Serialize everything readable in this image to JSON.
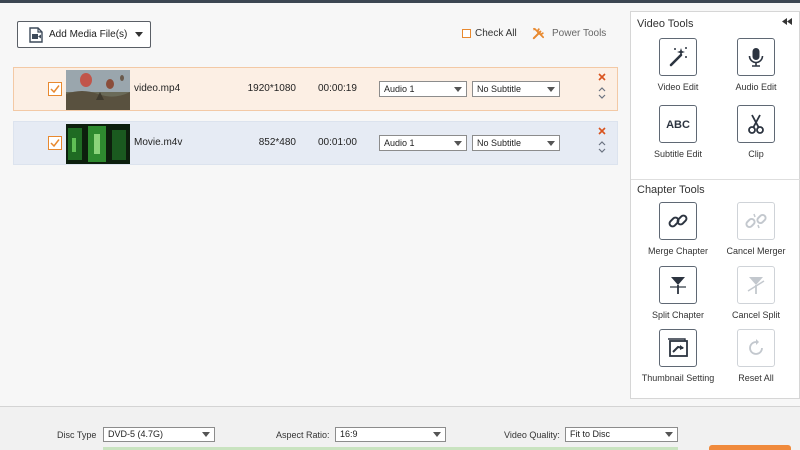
{
  "toolbar": {
    "add_media_label": "Add Media File(s)",
    "check_all_label": "Check All",
    "power_tools_label": "Power Tools"
  },
  "files": [
    {
      "name": "video.mp4",
      "resolution": "1920*1080",
      "duration": "00:00:19",
      "audio": "Audio 1",
      "subtitle": "No Subtitle",
      "selected": true
    },
    {
      "name": "Movie.m4v",
      "resolution": "852*480",
      "duration": "00:01:00",
      "audio": "Audio 1",
      "subtitle": "No Subtitle",
      "selected": false
    }
  ],
  "video_tools": {
    "title": "Video Tools",
    "items": [
      {
        "label": "Video Edit",
        "icon": "magic-wand-icon"
      },
      {
        "label": "Audio Edit",
        "icon": "microphone-icon"
      },
      {
        "label": "Subtitle Edit",
        "icon": "abc-icon"
      },
      {
        "label": "Clip",
        "icon": "scissors-icon"
      }
    ]
  },
  "chapter_tools": {
    "title": "Chapter Tools",
    "items": [
      {
        "label": "Merge Chapter",
        "icon": "link-icon",
        "enabled": true
      },
      {
        "label": "Cancel Merger",
        "icon": "broken-link-icon",
        "enabled": false
      },
      {
        "label": "Split Chapter",
        "icon": "split-icon",
        "enabled": true
      },
      {
        "label": "Cancel Split",
        "icon": "cancel-split-icon",
        "enabled": false
      },
      {
        "label": "Thumbnail Setting",
        "icon": "thumbnail-icon",
        "enabled": true
      },
      {
        "label": "Reset All",
        "icon": "reset-icon",
        "enabled": false
      }
    ]
  },
  "bottom": {
    "disc_type_label": "Disc Type",
    "disc_type_value": "DVD-5 (4.7G)",
    "aspect_ratio_label": "Aspect Ratio:",
    "aspect_ratio_value": "16:9",
    "video_quality_label": "Video Quality:",
    "video_quality_value": "Fit to Disc"
  },
  "colors": {
    "accent": "#e8892f",
    "selected_row": "#fcefe4",
    "row_bg": "#e6ebf4",
    "burn_button": "#f08a3c"
  }
}
